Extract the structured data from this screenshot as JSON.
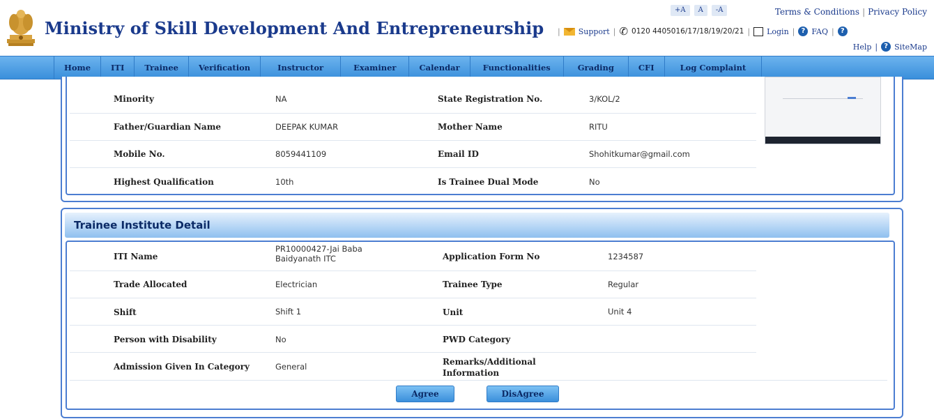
{
  "header": {
    "title": "Ministry of Skill Development And Entrepreneurship",
    "font_controls": [
      "+A",
      "A",
      "-A"
    ],
    "top_links": [
      "Terms & Conditions",
      "Privacy Policy"
    ],
    "support_label": "Support",
    "phone": "0120 4405016/17/18/19/20/21",
    "login_label": "Login",
    "faq_label": "FAQ",
    "help_label": "Help",
    "sitemap_label": "SiteMap"
  },
  "nav": {
    "items": [
      "Home",
      "ITI",
      "Trainee",
      "Verification",
      "Instructor",
      "Examiner",
      "Calendar",
      "Functionalities",
      "Grading",
      "CFI",
      "Log Complaint"
    ]
  },
  "personal": {
    "rows": [
      {
        "label1": "Minority",
        "value1": "NA",
        "label2": "State Registration No.",
        "value2": "3/KOL/2"
      },
      {
        "label1": "Father/Guardian Name",
        "value1": "DEEPAK KUMAR",
        "label2": "Mother Name",
        "value2": "RITU"
      },
      {
        "label1": "Mobile No.",
        "value1": "8059441109",
        "label2": "Email ID",
        "value2": "Shohitkumar@gmail.com"
      },
      {
        "label1": "Highest Qualification",
        "value1": "10th",
        "label2": "Is Trainee Dual Mode",
        "value2": "No"
      }
    ]
  },
  "institute": {
    "title": "Trainee Institute Detail",
    "rows": [
      {
        "label1": "ITI Name",
        "value1": "PR10000427-Jai Baba Baidyanath ITC",
        "label2": "Application Form No",
        "value2": "1234587"
      },
      {
        "label1": "Trade Allocated",
        "value1": "Electrician",
        "label2": "Trainee Type",
        "value2": "Regular"
      },
      {
        "label1": "Shift",
        "value1": "Shift 1",
        "label2": "Unit",
        "value2": "Unit 4"
      },
      {
        "label1": "Person with Disability",
        "value1": "No",
        "label2": "PWD Category",
        "value2": ""
      },
      {
        "label1": "Admission Given In Category",
        "value1": "General",
        "label2": "Remarks/Additional Information",
        "value2": ""
      }
    ],
    "agree_label": "Agree",
    "disagree_label": "DisAgree"
  },
  "colors": {
    "brand": "#1a3a8c",
    "nav": "#3a8fdb",
    "panel_border": "#4b7dd1"
  }
}
